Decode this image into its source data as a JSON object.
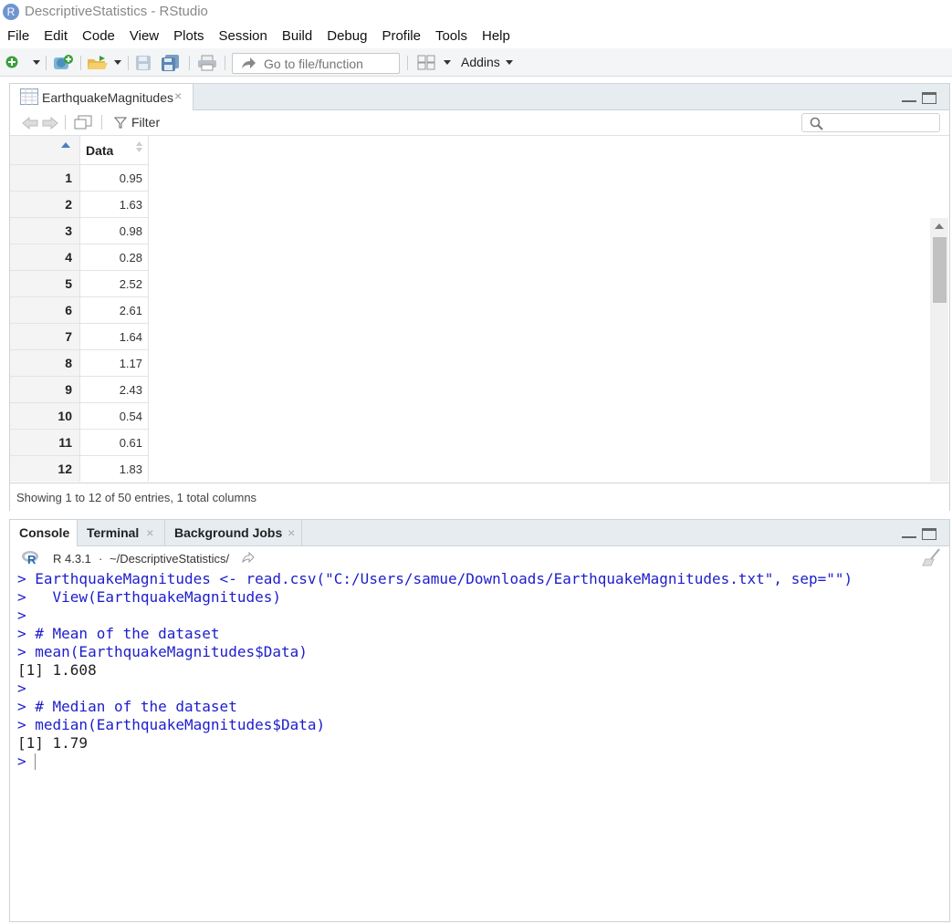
{
  "window": {
    "title": "DescriptiveStatistics - RStudio",
    "logo_letter": "R"
  },
  "menu": [
    "File",
    "Edit",
    "Code",
    "View",
    "Plots",
    "Session",
    "Build",
    "Debug",
    "Profile",
    "Tools",
    "Help"
  ],
  "toolbar": {
    "goto_placeholder": "Go to file/function",
    "addins_label": "Addins"
  },
  "viewer": {
    "tab_label": "EarthquakeMagnitudes",
    "filter_label": "Filter",
    "column_header": "Data",
    "rows": [
      {
        "n": "1",
        "v": "0.95"
      },
      {
        "n": "2",
        "v": "1.63"
      },
      {
        "n": "3",
        "v": "0.98"
      },
      {
        "n": "4",
        "v": "0.28"
      },
      {
        "n": "5",
        "v": "2.52"
      },
      {
        "n": "6",
        "v": "2.61"
      },
      {
        "n": "7",
        "v": "1.64"
      },
      {
        "n": "8",
        "v": "1.17"
      },
      {
        "n": "9",
        "v": "2.43"
      },
      {
        "n": "10",
        "v": "0.54"
      },
      {
        "n": "11",
        "v": "0.61"
      },
      {
        "n": "12",
        "v": "1.83"
      }
    ],
    "status": "Showing 1 to 12 of 50 entries, 1 total columns"
  },
  "console": {
    "tabs": [
      "Console",
      "Terminal",
      "Background Jobs"
    ],
    "version": "R 4.3.1",
    "path": "~/DescriptiveStatistics/",
    "lines": [
      {
        "prompt": "> ",
        "text": "EarthquakeMagnitudes <- read.csv(\"C:/Users/samue/Downloads/EarthquakeMagnitudes.txt\", sep=\"\")",
        "kind": "input"
      },
      {
        "prompt": ">   ",
        "text": "View(EarthquakeMagnitudes)",
        "kind": "input"
      },
      {
        "prompt": "> ",
        "text": "",
        "kind": "input"
      },
      {
        "prompt": "> ",
        "text": "# Mean of the dataset",
        "kind": "input"
      },
      {
        "prompt": "> ",
        "text": "mean(EarthquakeMagnitudes$Data)",
        "kind": "input"
      },
      {
        "prompt": "",
        "text": "[1] 1.608",
        "kind": "output"
      },
      {
        "prompt": "> ",
        "text": "",
        "kind": "input"
      },
      {
        "prompt": "> ",
        "text": "# Median of the dataset",
        "kind": "input"
      },
      {
        "prompt": "> ",
        "text": "median(EarthquakeMagnitudes$Data)",
        "kind": "input"
      },
      {
        "prompt": "",
        "text": "[1] 1.79",
        "kind": "output"
      },
      {
        "prompt": "> ",
        "text": "",
        "kind": "cursor"
      }
    ]
  }
}
